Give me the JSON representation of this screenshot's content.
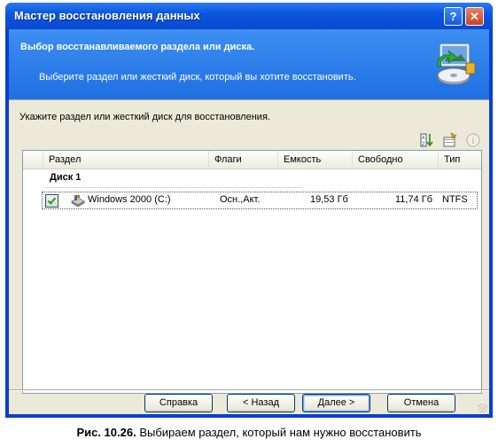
{
  "window": {
    "title": "Мастер восстановления данных",
    "help_glyph": "?",
    "close_glyph": "✕"
  },
  "header": {
    "title": "Выбор восстанавливаемого раздела или диска.",
    "subtitle": "Выберите раздел или жесткий диск, который вы хотите восстановить."
  },
  "instruction": "Укажите раздел или жесткий диск для восстановления.",
  "toolbar": {
    "icons": [
      "sort-icon",
      "properties-icon",
      "info-icon"
    ]
  },
  "table": {
    "columns": [
      "Раздел",
      "Флаги",
      "Емкость",
      "Свободно",
      "Тип"
    ],
    "group": "Диск 1",
    "rows": [
      {
        "checked": true,
        "partition": "Windows 2000 (C:)",
        "flags": "Осн.,Акт.",
        "capacity": "19,53 Гб",
        "free": "11,74 Гб",
        "type": "NTFS"
      }
    ]
  },
  "buttons": {
    "help": "Справка",
    "back": "< Назад",
    "next": "Далее >",
    "cancel": "Отмена"
  },
  "caption": {
    "number": "Рис. 10.26.",
    "text": " Выбираем раздел, который нам нужно восстановить"
  },
  "colors": {
    "title_bar": "#0a48d0",
    "header_bg": "#2f7ee9",
    "dialog_bg": "#ece9d8"
  }
}
